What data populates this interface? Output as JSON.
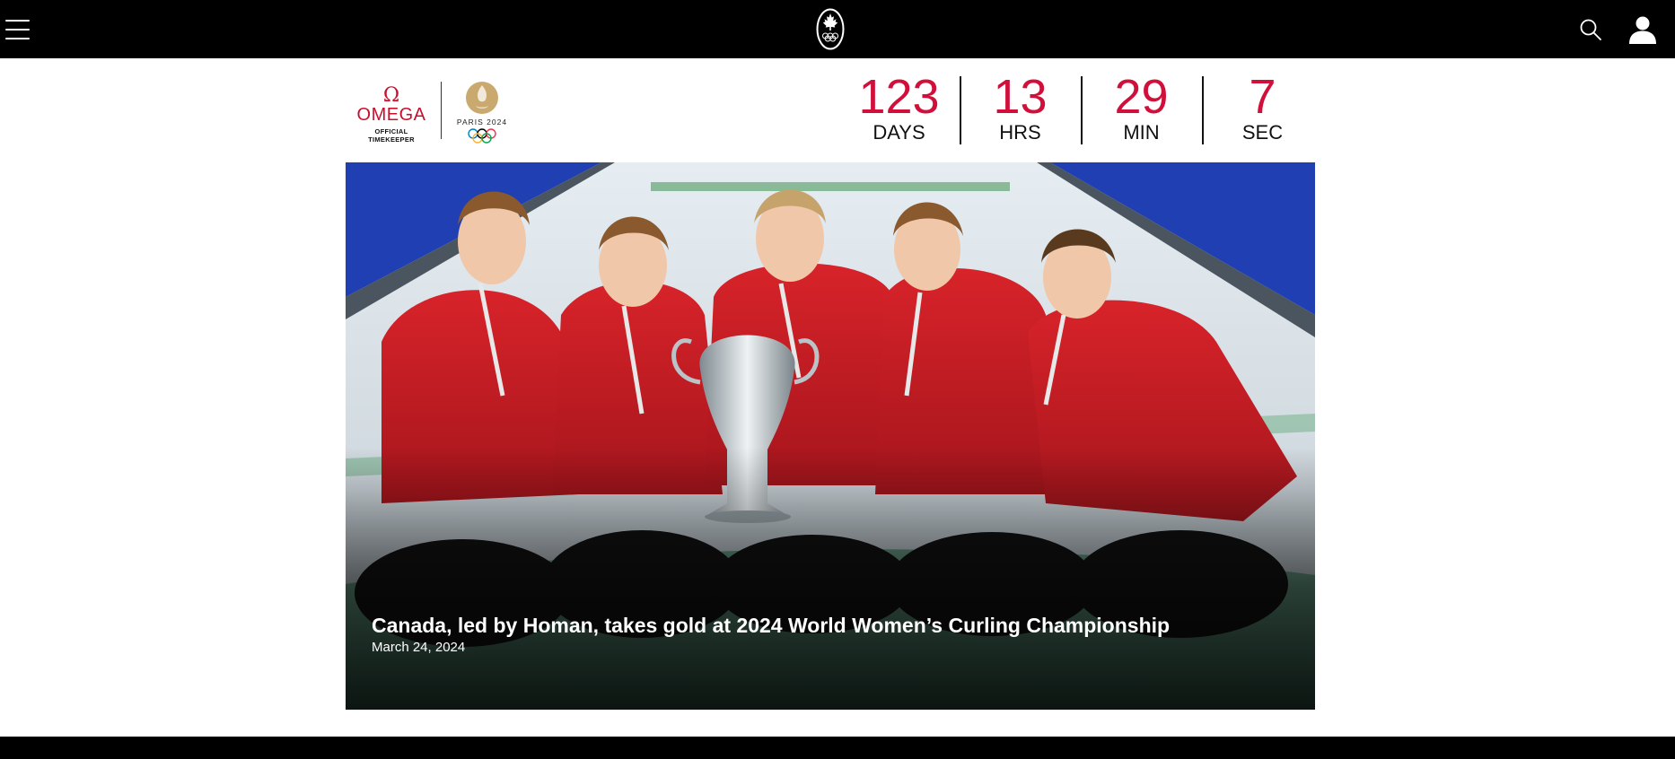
{
  "nav": {
    "menu_icon": "hamburger-menu-icon",
    "logo_icon": "team-canada-maple-leaf-olympic-rings-logo",
    "search_icon": "search-icon",
    "account_icon": "user-account-icon"
  },
  "sponsor": {
    "omega_symbol": "Ω",
    "omega_name": "OMEGA",
    "omega_tagline": "OFFICIAL TIMEKEEPER",
    "paris_text": "PARIS 2024"
  },
  "countdown": {
    "days": {
      "value": "123",
      "label": "DAYS"
    },
    "hours": {
      "value": "13",
      "label": "HRS"
    },
    "minutes": {
      "value": "29",
      "label": "MIN"
    },
    "seconds": {
      "value": "7",
      "label": "SEC"
    }
  },
  "hero": {
    "title": "Canada, led by Homan, takes gold at 2024 World Women’s Curling Championship",
    "date": "March 24, 2024"
  },
  "colors": {
    "nav_background": "#000000",
    "countdown_accent": "#d0103a",
    "omega_red": "#c8102e",
    "paris_gold": "#c9a96e"
  }
}
